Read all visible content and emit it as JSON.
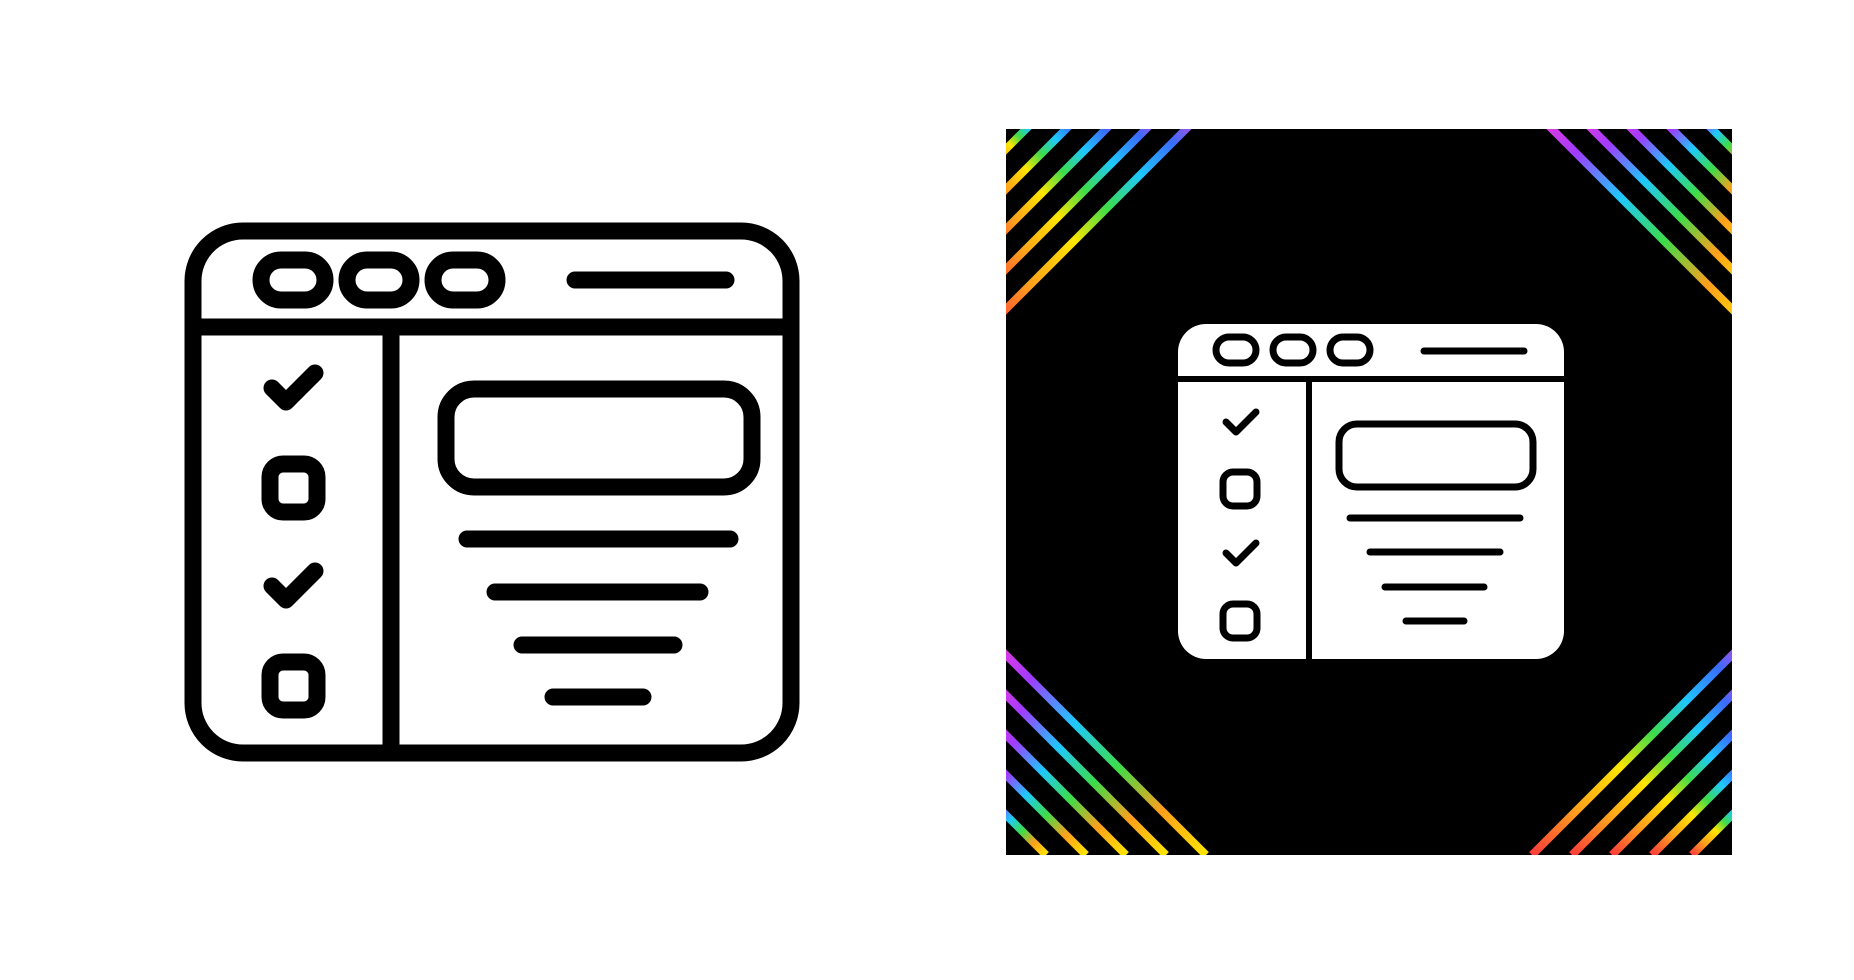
{
  "colors": {
    "background": "#ffffff",
    "ink": "#000000",
    "tile_background": "#000000",
    "glyph_fill": "#ffffff",
    "rainbow_stripes": [
      "#ff3b3b",
      "#ff9f1c",
      "#ffe600",
      "#3ddc4a",
      "#1ec8ff",
      "#3b6bff",
      "#a03bff",
      "#ff3bd0"
    ]
  },
  "icons": [
    {
      "name": "browser-window-checklist-icon",
      "style": "outline",
      "window_buttons": 3,
      "checklist": [
        "checked",
        "unchecked",
        "checked",
        "unchecked"
      ],
      "content_lines": 4
    },
    {
      "name": "browser-window-checklist-icon",
      "style": "glyph-on-black-tile",
      "window_buttons": 3,
      "checklist": [
        "checked",
        "unchecked",
        "checked",
        "unchecked"
      ],
      "content_lines": 4,
      "decoration": "rainbow-diagonal-stripe-corners-icon"
    }
  ]
}
